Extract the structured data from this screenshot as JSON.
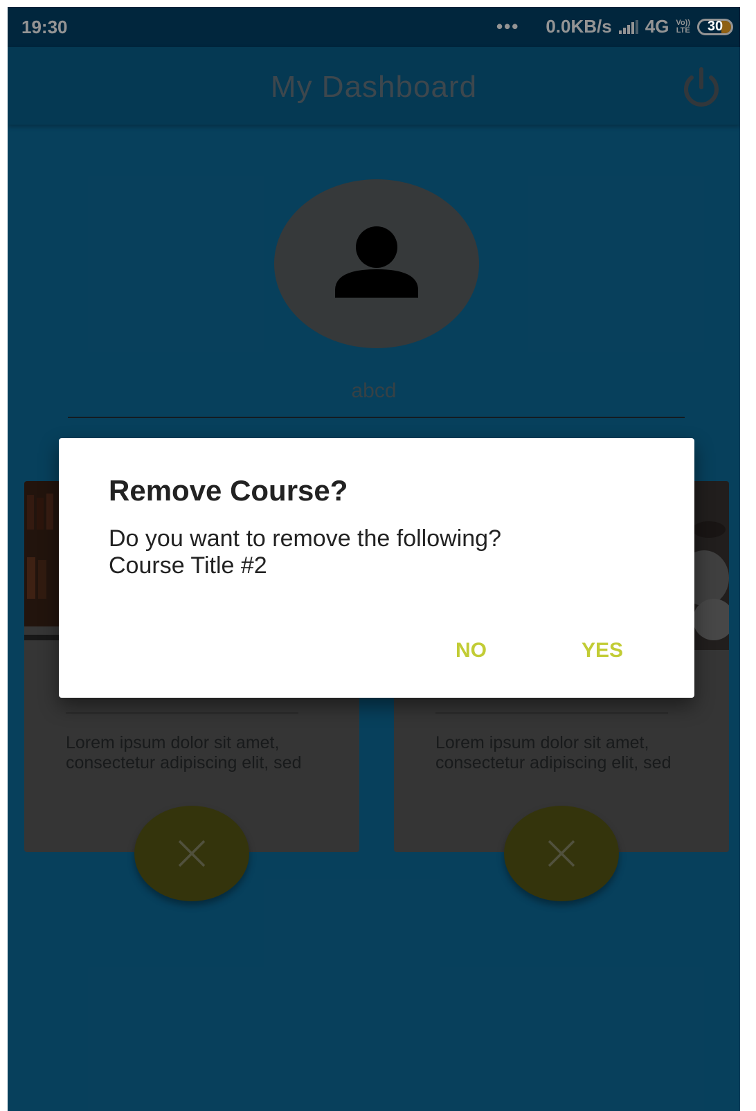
{
  "status_bar": {
    "time": "19:30",
    "dots": "•••",
    "network_speed": "0.0KB/s",
    "network_type": "4G",
    "volte_top": "Vo))",
    "volte_bottom": "LTE",
    "battery": "30"
  },
  "app_bar": {
    "title": "My Dashboard",
    "power_icon": "power-icon"
  },
  "profile": {
    "avatar_icon": "person-icon",
    "username": "abcd"
  },
  "courses": [
    {
      "description": "Lorem ipsum dolor sit amet, consectetur adipiscing elit, sed",
      "remove_icon": "close-icon"
    },
    {
      "description": "Lorem ipsum dolor sit amet, consectetur adipiscing elit, sed",
      "remove_icon": "close-icon"
    }
  ],
  "dialog": {
    "title": "Remove Course?",
    "message_line1": "Do you want to remove the following?",
    "message_line2": "Course Title #2",
    "no_label": "NO",
    "yes_label": "YES"
  },
  "colors": {
    "background": "#0d6e9f",
    "status_bar": "#02426a",
    "accent": "#c2cc35",
    "fab": "#5a5b16"
  }
}
